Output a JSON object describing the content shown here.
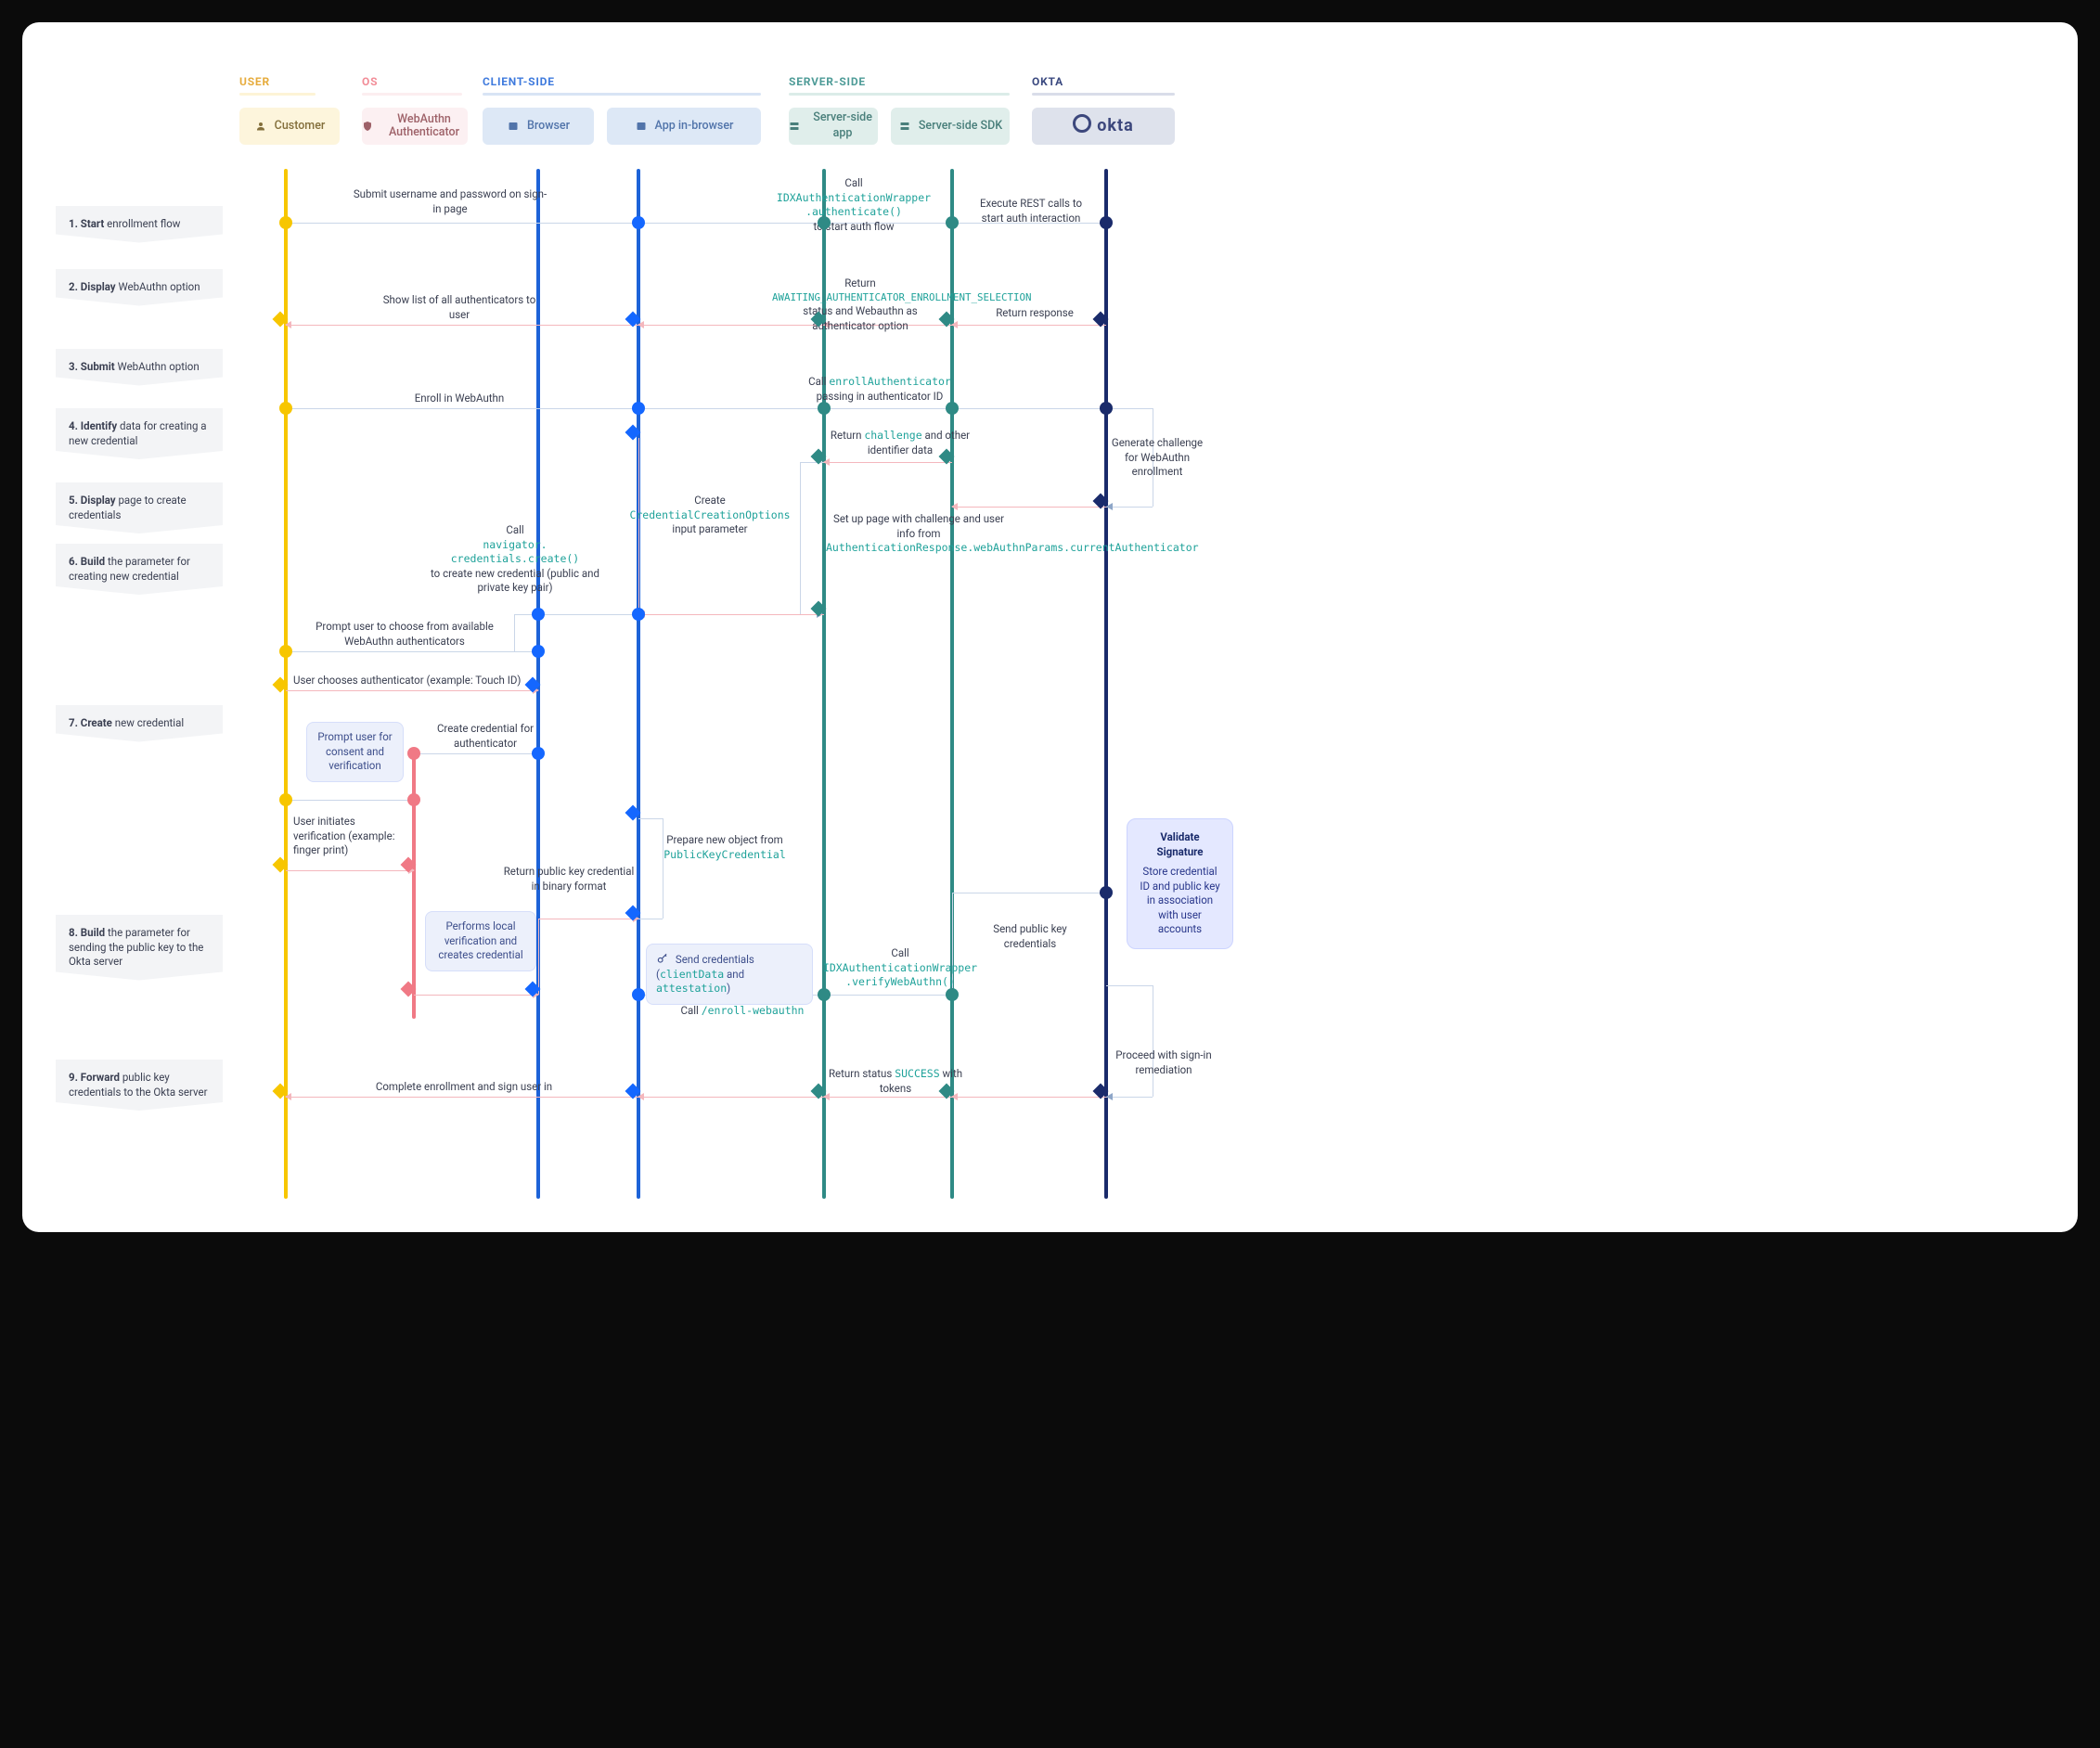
{
  "lanes": {
    "user": {
      "label": "USER",
      "box": "Customer"
    },
    "os": {
      "label": "OS",
      "box": "WebAuthn Authenticator"
    },
    "client": {
      "label": "CLIENT-SIDE",
      "boxes": [
        "Browser",
        "App in-browser"
      ]
    },
    "server": {
      "label": "SERVER-SIDE",
      "boxes": [
        "Server-side app",
        "Server-side SDK"
      ]
    },
    "okta": {
      "label": "OKTA",
      "box": "okta"
    }
  },
  "steps": [
    {
      "num": "1.",
      "bold": "Start",
      "rest": " enrollment flow"
    },
    {
      "num": "2.",
      "bold": "Display",
      "rest": " WebAuthn option"
    },
    {
      "num": "3.",
      "bold": "Submit",
      "rest": " WebAuthn option"
    },
    {
      "num": "4.",
      "bold": "Identify",
      "rest": " data for creating a new credential"
    },
    {
      "num": "5.",
      "bold": "Display",
      "rest": " page to create credentials"
    },
    {
      "num": "6.",
      "bold": "Build",
      "rest": " the parameter for creating new credential"
    },
    {
      "num": "7.",
      "bold": "Create",
      "rest": " new credential"
    },
    {
      "num": "8.",
      "bold": "Build",
      "rest": " the parameter for sending the public key to the Okta server"
    },
    {
      "num": "9.",
      "bold": "Forward",
      "rest": " public key credentials to the Okta server"
    }
  ],
  "messages": {
    "m1": "Submit username and password on sign-in page",
    "m2_pre": "Call ",
    "m2_code": "IDXAuthenticationWrapper\n.authenticate()",
    "m2_post": " to start auth flow",
    "m3": "Execute REST calls to start auth interaction",
    "m4": "Return response",
    "m5_pre": "Return ",
    "m5_code": "AWAITING_AUTHENTICATOR_ENROLLMENT_SELECTION",
    "m5_post": " status and Webauthn as authenticator option",
    "m6": "Show list of all authenticators to user",
    "m7": "Enroll in WebAuthn",
    "m8_pre": "Call ",
    "m8_code": "enrollAuthenticator",
    "m8_post": " passing in authenticator ID",
    "m9": "Generate challenge for WebAuthn enrollment",
    "m10_pre": "Return ",
    "m10_code": "challenge",
    "m10_post": " and other identifier data",
    "m11_pre": "Set up page with challenge and user info from ",
    "m11_code": "AuthenticationResponse.webAuthnParams.currentAuthenticator",
    "m12_pre": "Create ",
    "m12_code": "CredentialCreationOptions",
    "m12_post": " input parameter",
    "m13_pre": "Call ",
    "m13_code": "navigator.\ncredentials.create()",
    "m13_post": " to create new credential (public and private key pair)",
    "m14": "Prompt user to choose from available WebAuthn authenticators",
    "m15": "User chooses authenticator (example: Touch ID)",
    "m16": "Create credential for authenticator",
    "m17": "Prompt user for consent and verification",
    "m18": "User initiates verification (example:  finger print)",
    "m19": "Performs local verification and creates credential",
    "m20": "Return public key credential in binary format",
    "m21_pre": "Prepare new object from ",
    "m21_code": "PublicKeyCredential",
    "m22_pre": "Send credentials (",
    "m22_code1": "clientData",
    "m22_mid": " and ",
    "m22_code2": "attestation",
    "m22_post": ")",
    "m23_pre": "Call ",
    "m23_code": "IDXAuthenticationWrapper\n.verifyWebAuthn()",
    "m24_pre": "Call ",
    "m24_code": "/enroll-webauthn",
    "m25": "Send public key credentials",
    "m26_title": "Validate Signature",
    "m26_body": "Store credential ID and public key in association with user accounts",
    "m27": "Proceed with sign-in remediation",
    "m28_pre": "Return status ",
    "m28_code": "SUCCESS",
    "m28_post": " with tokens",
    "m29": "Complete enrollment and sign user in"
  }
}
